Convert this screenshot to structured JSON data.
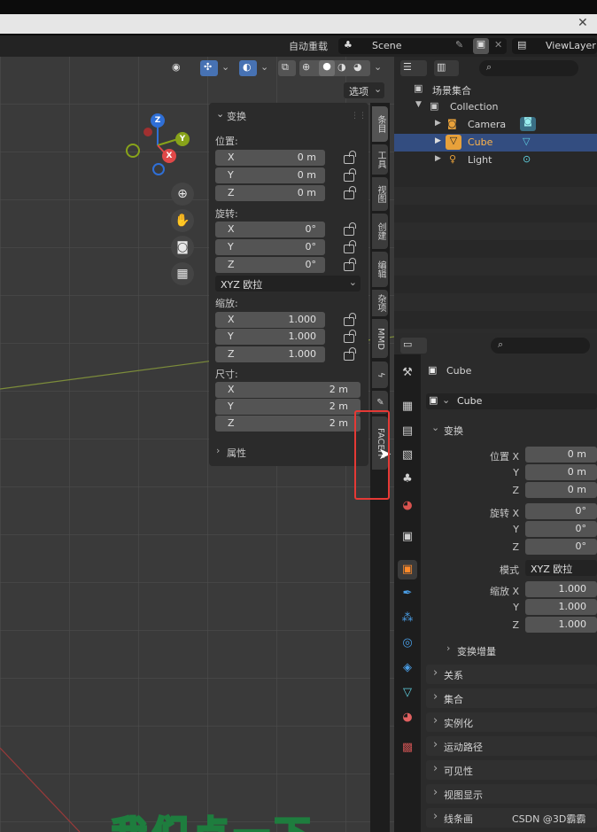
{
  "header": {
    "auto_save": "自动重载",
    "scene": "Scene",
    "view_layer": "ViewLayer"
  },
  "viewport": {
    "options_label": "选项"
  },
  "npanel": {
    "transform_title": "变换",
    "location_label": "位置:",
    "location": [
      {
        "axis": "X",
        "value": "0 m"
      },
      {
        "axis": "Y",
        "value": "0 m"
      },
      {
        "axis": "Z",
        "value": "0 m"
      }
    ],
    "rotation_label": "旋转:",
    "rotation": [
      {
        "axis": "X",
        "value": "0°"
      },
      {
        "axis": "Y",
        "value": "0°"
      },
      {
        "axis": "Z",
        "value": "0°"
      }
    ],
    "rotation_mode": "XYZ 欧拉",
    "scale_label": "缩放:",
    "scale": [
      {
        "axis": "X",
        "value": "1.000"
      },
      {
        "axis": "Y",
        "value": "1.000"
      },
      {
        "axis": "Z",
        "value": "1.000"
      }
    ],
    "dimensions_label": "尺寸:",
    "dimensions": [
      {
        "axis": "X",
        "value": "2 m"
      },
      {
        "axis": "Y",
        "value": "2 m"
      },
      {
        "axis": "Z",
        "value": "2 m"
      }
    ],
    "properties_label": "属性"
  },
  "vtabs": [
    "条目",
    "工具",
    "视图",
    "创建",
    "编辑",
    "杂项",
    "MMD",
    "",
    "",
    "FACEIT"
  ],
  "gizmo": {
    "z": "Z",
    "y": "Y",
    "x": "X"
  },
  "outliner": {
    "scene_collection": "场景集合",
    "collection": "Collection",
    "items": [
      "Camera",
      "Cube",
      "Light"
    ]
  },
  "properties": {
    "object_name": "Cube",
    "data_name": "Cube",
    "transform_title": "变换",
    "location_label": "位置 X",
    "location": [
      "0 m",
      "0 m",
      "0 m"
    ],
    "rotation_label": "旋转 X",
    "rotation": [
      "0°",
      "0°",
      "0°"
    ],
    "mode_label": "模式",
    "mode_value": "XYZ 欧拉",
    "scale_label": "缩放 X",
    "scale": [
      "1.000",
      "1.000",
      "1.000"
    ],
    "axis_y": "Y",
    "axis_z": "Z",
    "delta_transform": "变换增量",
    "sections": [
      "关系",
      "集合",
      "实例化",
      "运动路径",
      "可见性",
      "视图显示",
      "线条画"
    ]
  },
  "subtitle": "我们点一下",
  "watermark": "CSDN @3D霸霸",
  "colors": {
    "accent": "#4772b3",
    "highlight_box": "#e53935"
  }
}
